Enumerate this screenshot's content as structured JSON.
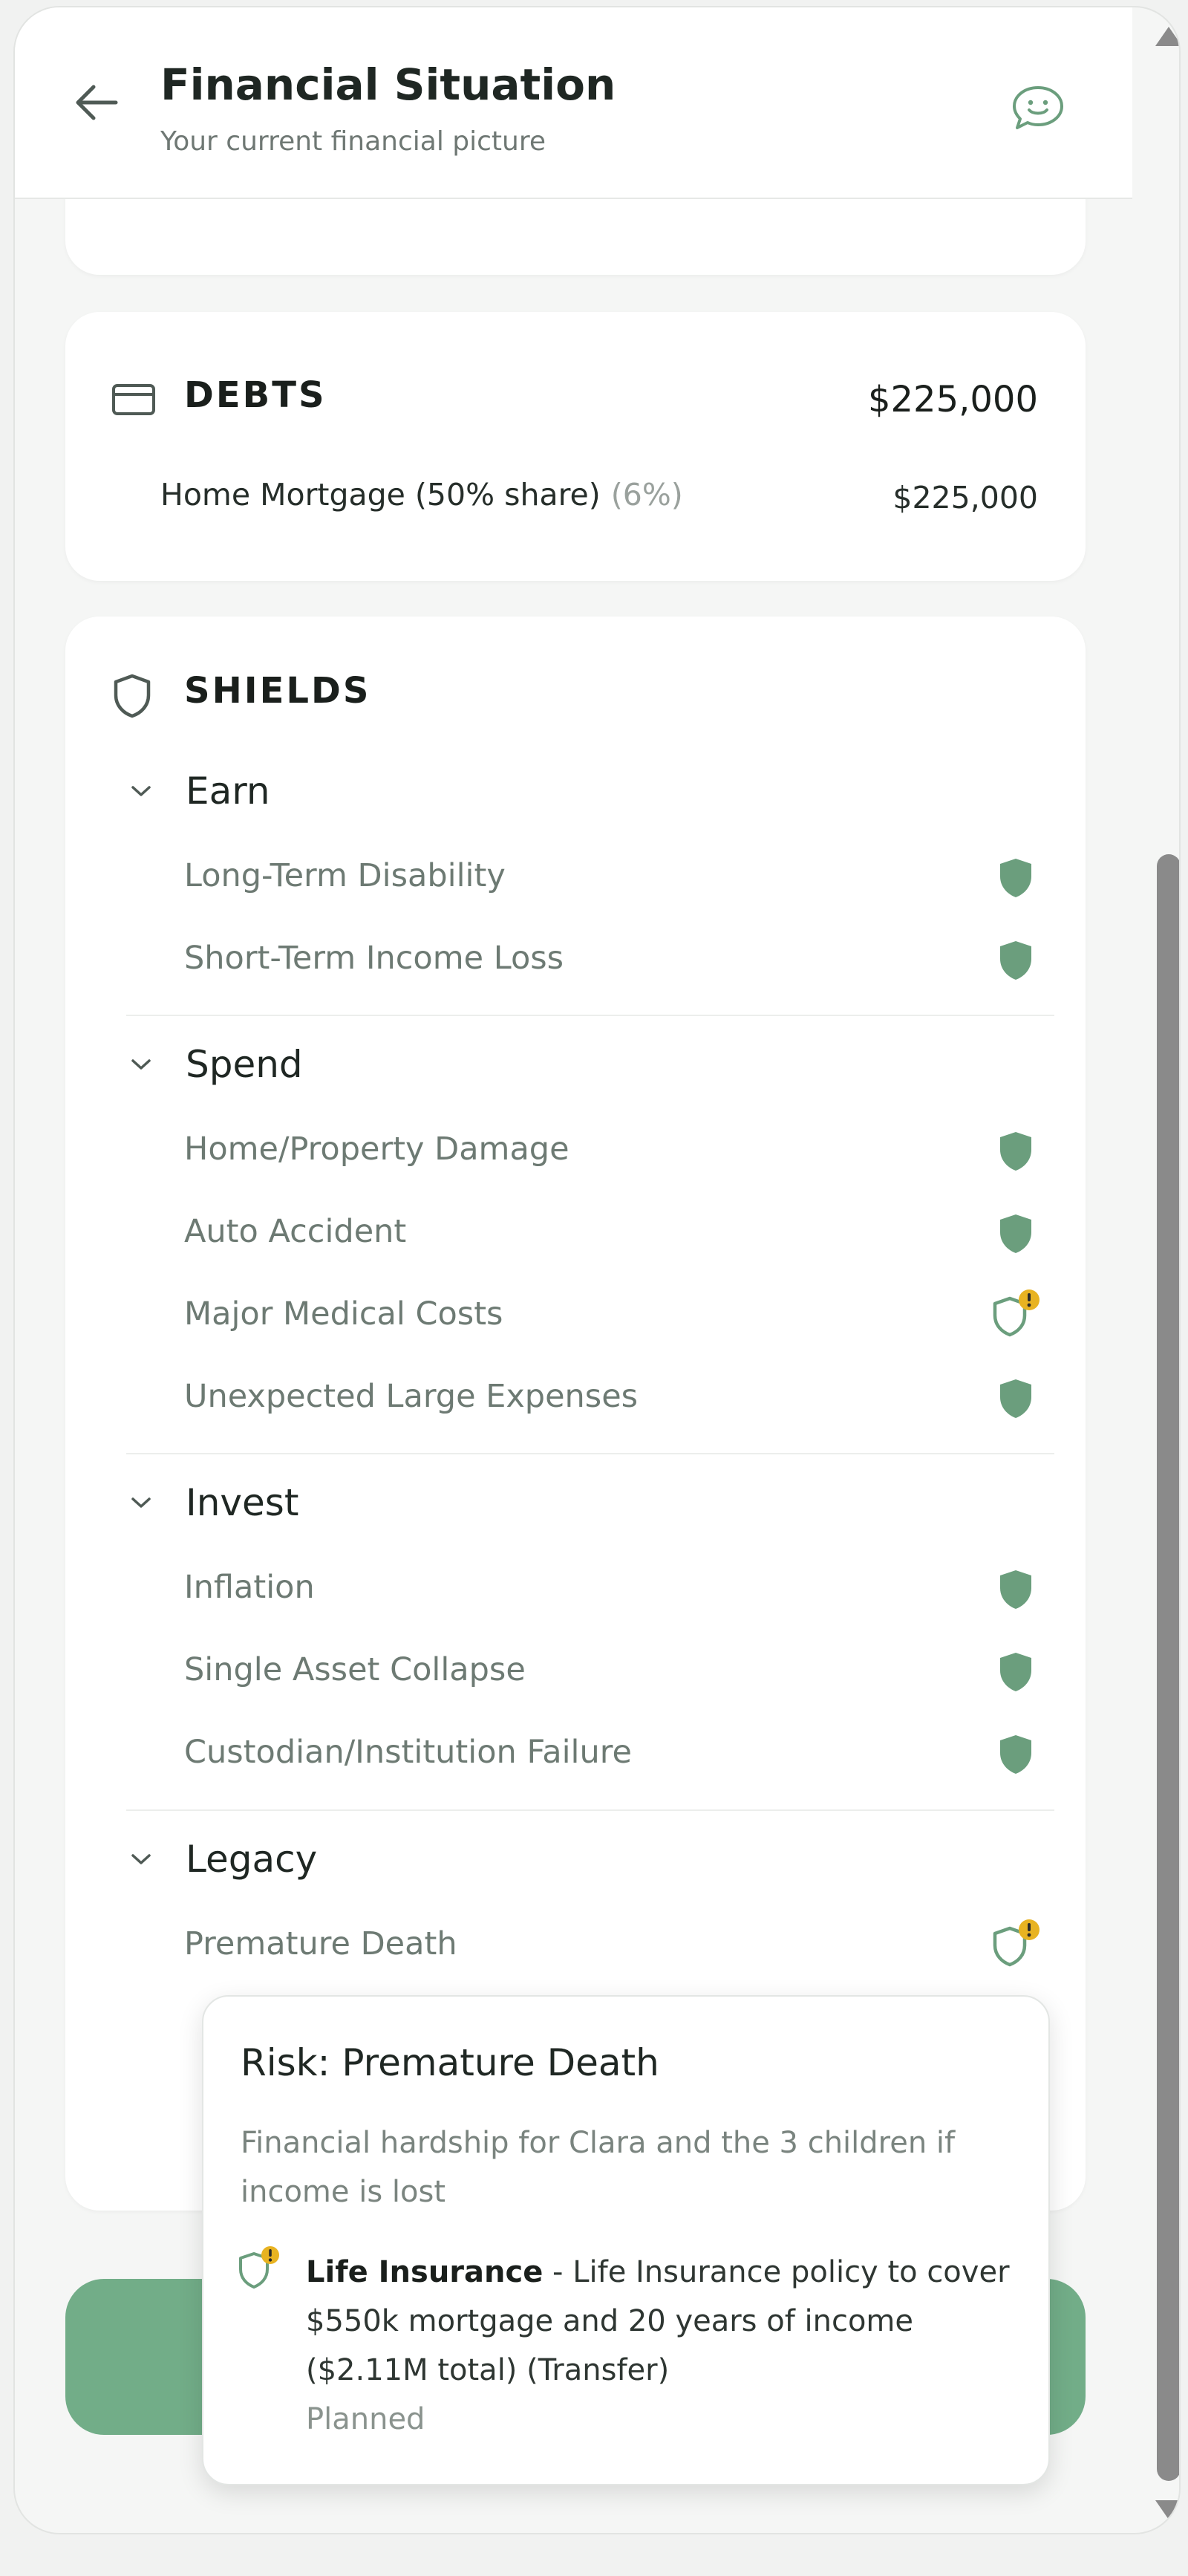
{
  "header": {
    "title": "Financial Situation",
    "subtitle": "Your current financial picture",
    "back_icon": "arrow-left-icon",
    "chat_icon": "chat-smile-icon"
  },
  "debts": {
    "title": "DEBTS",
    "icon": "credit-card-icon",
    "total": "$225,000",
    "items": [
      {
        "label": "Home Mortgage (50% share)",
        "rate": "(6%)",
        "value": "$225,000"
      }
    ]
  },
  "shields": {
    "title": "SHIELDS",
    "icon": "shield-outline-icon",
    "groups": [
      {
        "label": "Earn",
        "items": [
          {
            "label": "Long-Term Disability",
            "status": "covered"
          },
          {
            "label": "Short-Term Income Loss",
            "status": "covered"
          }
        ]
      },
      {
        "label": "Spend",
        "items": [
          {
            "label": "Home/Property Damage",
            "status": "covered"
          },
          {
            "label": "Auto Accident",
            "status": "covered"
          },
          {
            "label": "Major Medical Costs",
            "status": "warning"
          },
          {
            "label": "Unexpected Large Expenses",
            "status": "covered"
          }
        ]
      },
      {
        "label": "Invest",
        "items": [
          {
            "label": "Inflation",
            "status": "covered"
          },
          {
            "label": "Single Asset Collapse",
            "status": "covered"
          },
          {
            "label": "Custodian/Institution Failure",
            "status": "covered"
          }
        ]
      },
      {
        "label": "Legacy",
        "items": [
          {
            "label": "Premature Death",
            "status": "warning"
          }
        ]
      }
    ]
  },
  "tooltip": {
    "title": "Risk: Premature Death",
    "description": "Financial hardship for Clara and the 3 children if income is lost",
    "mitigation_name": "Life Insurance",
    "mitigation_detail": " - Life Insurance policy to cover $550k mortgage and 20 years of income ($2.11M total) (Transfer)",
    "mitigation_status": "Planned"
  },
  "colors": {
    "accent_green": "#72ad88",
    "shield_green": "#6b9e7d",
    "warning_yellow": "#e8b322",
    "text_dark": "#1f2723",
    "text_muted": "#6d7a73"
  }
}
